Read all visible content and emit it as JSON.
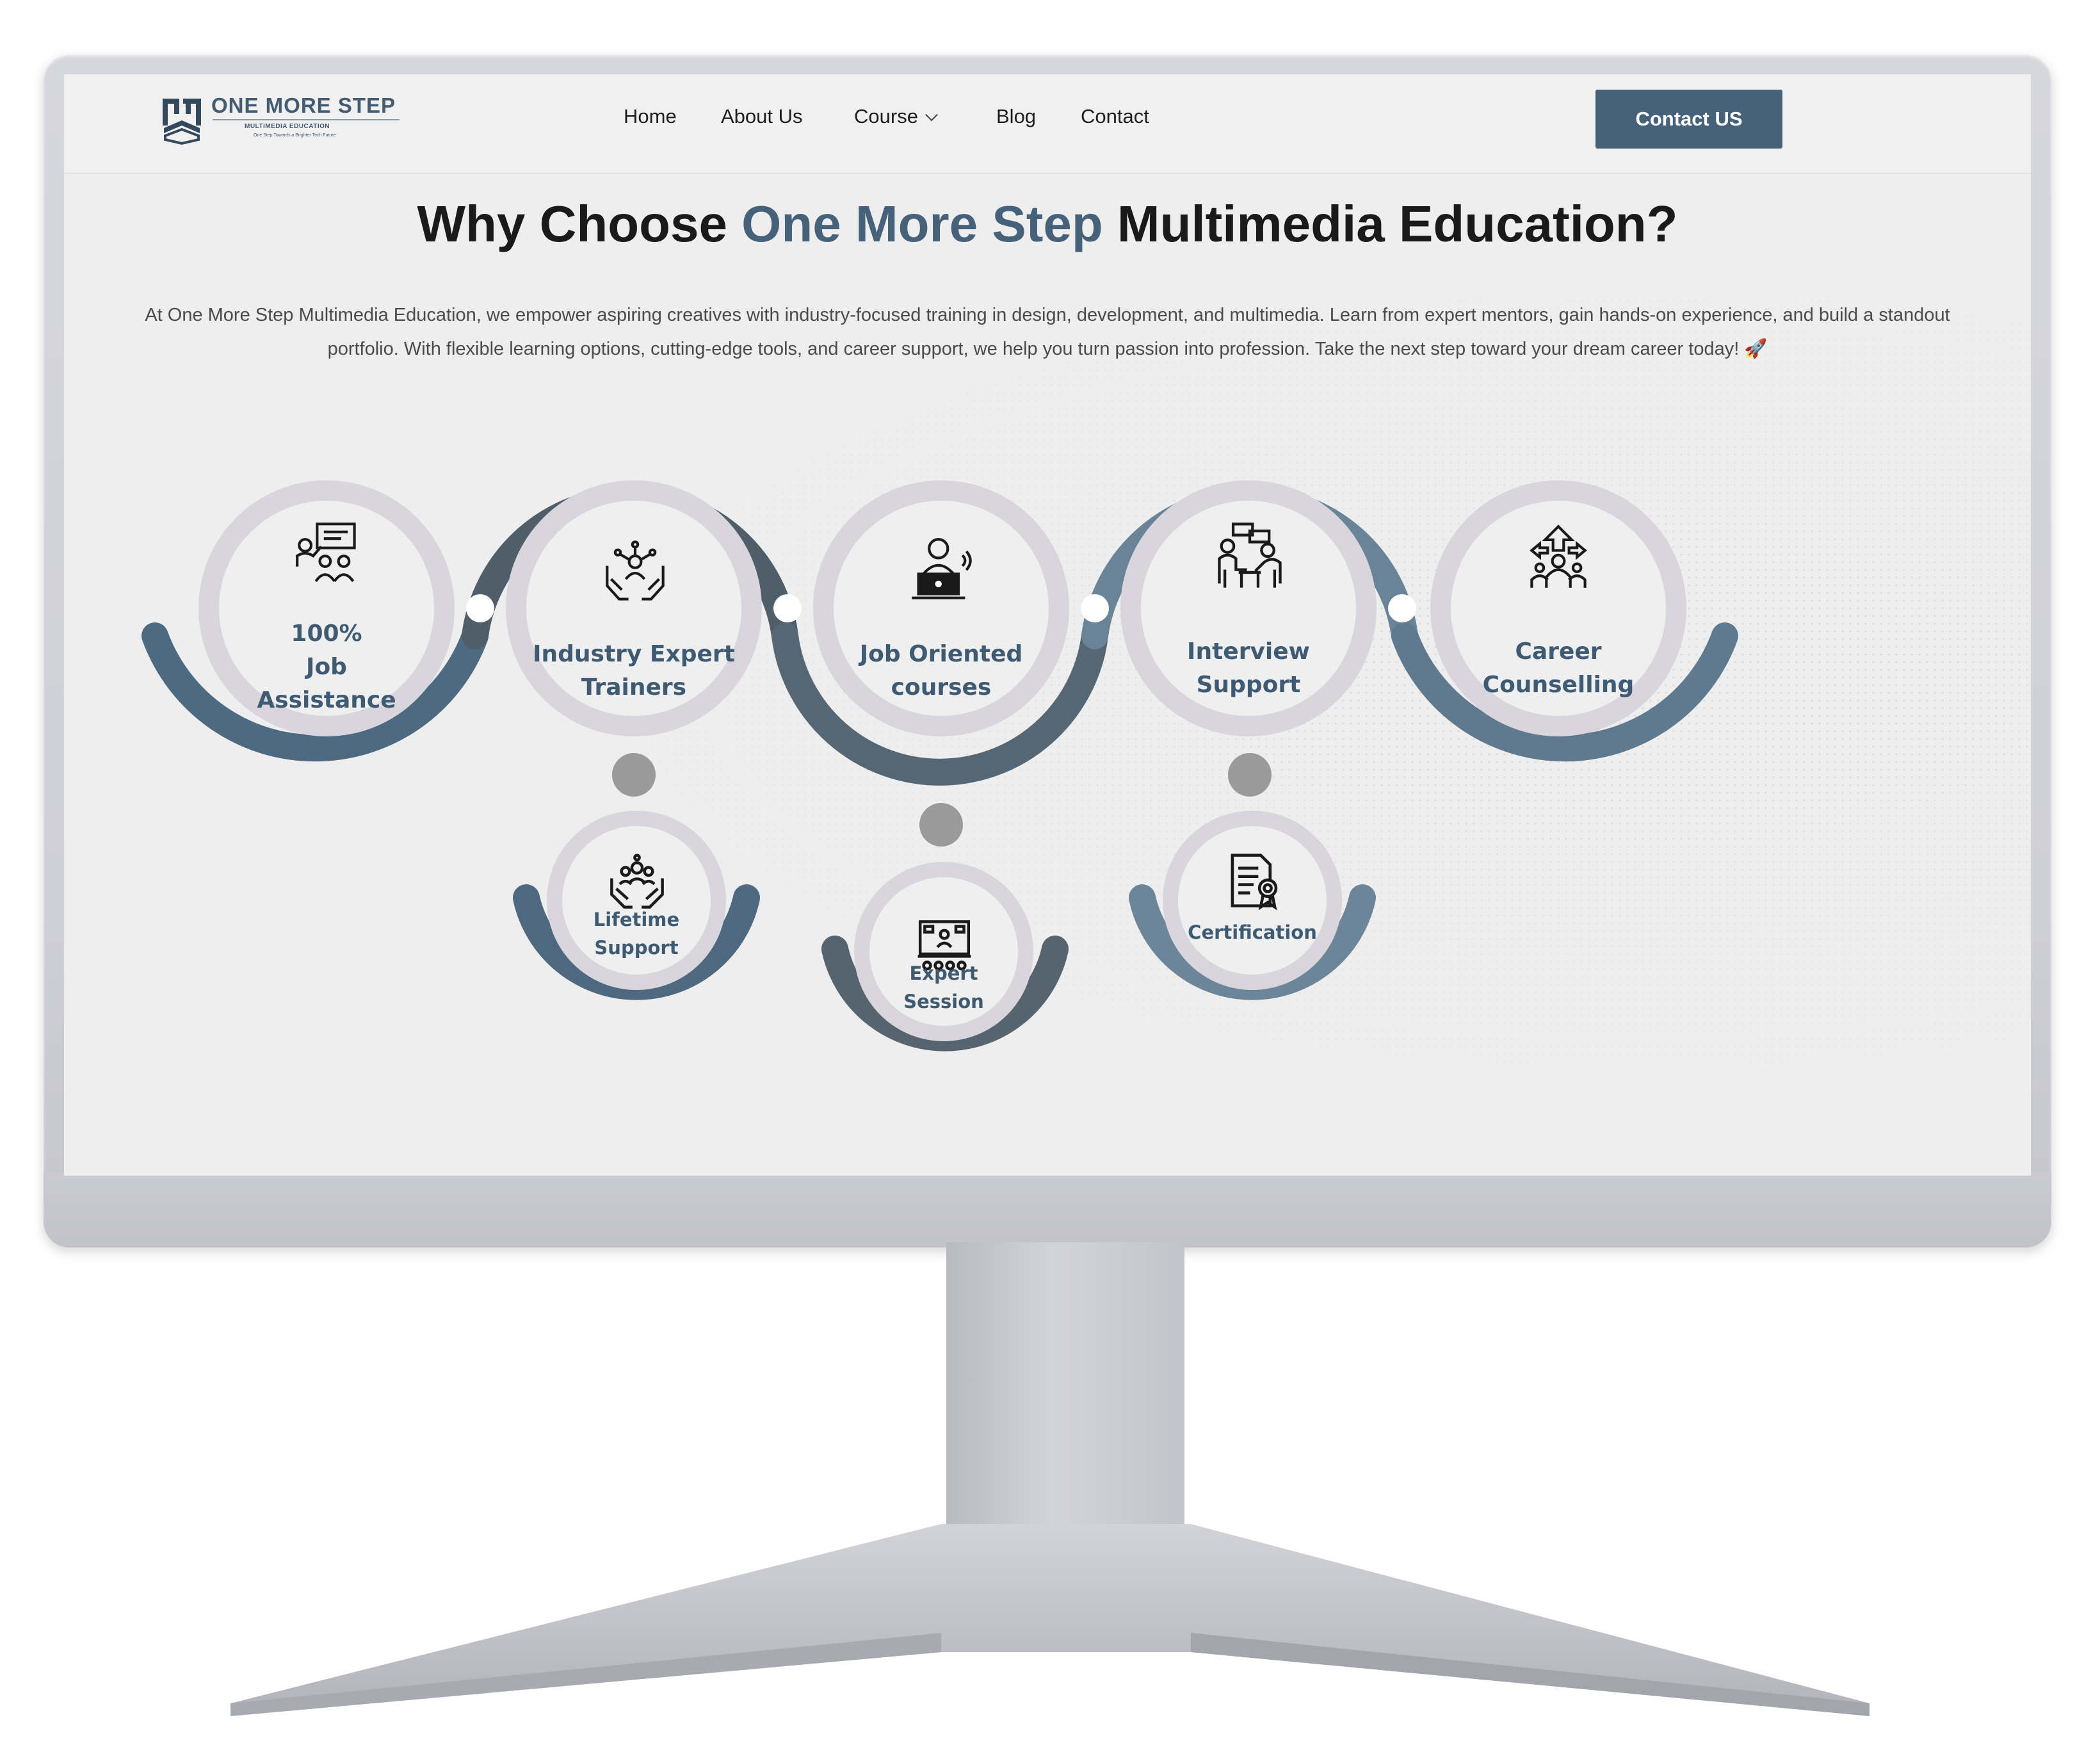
{
  "brand": {
    "name": "ONE MORE STEP",
    "subtitle": "MULTIMEDIA EDUCATION",
    "tagline": "One Step Towards a Brighter Tech Future"
  },
  "nav": {
    "items": [
      "Home",
      "About Us",
      "Course",
      "Blog",
      "Contact"
    ],
    "cta_label": "Contact US"
  },
  "headline": {
    "part1": "Why Choose ",
    "accent": "One More Step",
    "part2": " Multimedia Education?"
  },
  "intro": "At One More Step Multimedia Education, we empower aspiring creatives with industry-focused training in design, development, and multimedia. Learn from expert mentors, gain hands-on experience, and build a standout portfolio. With flexible learning options, cutting-edge tools, and career support, we help you turn passion into profession. Take the next step toward your dream career today! 🚀",
  "features": {
    "main": [
      {
        "line1": "100%",
        "line2": "Job",
        "line3": "Assistance",
        "icon": "presentation-icon"
      },
      {
        "line1": "Industry Expert",
        "line2": "Trainers",
        "icon": "team-hands-icon"
      },
      {
        "line1": "Job Oriented",
        "line2": "courses",
        "icon": "laptop-user-icon"
      },
      {
        "line1": "Interview",
        "line2": "Support",
        "icon": "interview-icon"
      },
      {
        "line1": "Career",
        "line2": "Counselling",
        "icon": "career-arrows-icon"
      }
    ],
    "secondary": [
      {
        "line1": "Lifetime",
        "line2": "Support",
        "icon": "support-hands-icon"
      },
      {
        "line1": "Expert",
        "line2": "Session",
        "icon": "session-board-icon"
      },
      {
        "line1": "Certification",
        "icon": "certificate-icon"
      }
    ]
  },
  "colors": {
    "accent": "#46617a",
    "arc_dark": "#505f6b",
    "arc_light": "#6a8498",
    "ring": "#d8d6dc",
    "connector_dot": "#999999"
  }
}
